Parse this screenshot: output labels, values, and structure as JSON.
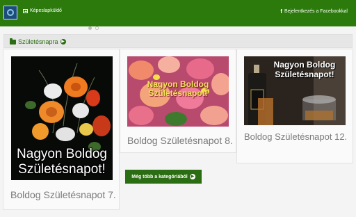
{
  "header": {
    "gallery_label": "Képeslapküldő",
    "facebook_label": "Bejelentkezés a Facebookkal"
  },
  "category": {
    "title": "Születésnapra"
  },
  "cards": [
    {
      "title": "Boldog Születésnapot 7.",
      "overlay": "Nagyon Boldog Születésnapot!"
    },
    {
      "title": "Boldog Születésnapot 8.",
      "overlay": "Nagyon Boldog Születésnapot!"
    },
    {
      "title": "Boldog Születésnapot 12.",
      "overlay": "Nagyon Boldog Születésnapot!"
    }
  ],
  "more_button": {
    "label": "Még több a kategóriából"
  },
  "colors": {
    "header_bg": "#2b7a0b",
    "accent": "#2b6d12"
  },
  "icons": {
    "logo": "app-logo",
    "gallery": "image-icon",
    "facebook": "facebook-icon",
    "category": "folder-icon",
    "arrow": "arrow-circle-right-icon"
  }
}
